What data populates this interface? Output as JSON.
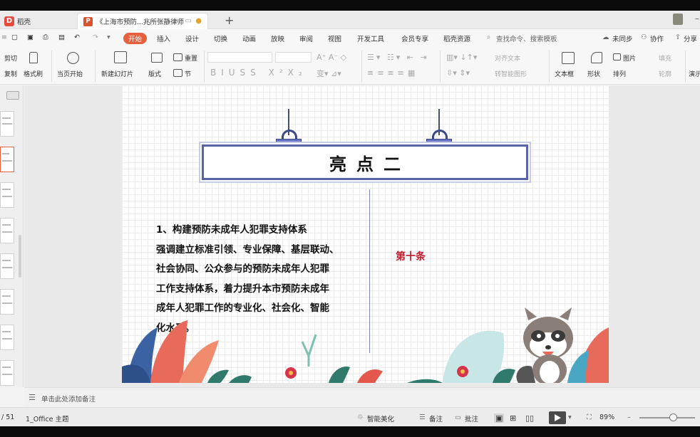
{
  "tabs": [
    {
      "label": "稻壳"
    },
    {
      "label": "《上海市预防...兆所张静律师"
    }
  ],
  "menu": {
    "start": "开始",
    "items": [
      "插入",
      "设计",
      "切换",
      "动画",
      "放映",
      "审阅",
      "视图",
      "开发工具",
      "会员专享",
      "稻壳资源"
    ],
    "search": "查找命令、搜索模板",
    "unsync": "未同步",
    "collab": "协作",
    "share": "分享"
  },
  "ribbon": {
    "cut": "剪切",
    "copy": "复制",
    "format_painter": "格式刷",
    "play_from_current": "当页开始",
    "new_slide": "新建幻灯片",
    "layout": "版式",
    "section": "节",
    "reset": "重置",
    "align_text": "对齐文本",
    "smartart": "转智能图形",
    "textbox": "文本框",
    "shape": "形状",
    "picture": "图片",
    "arrange": "排列",
    "fill": "填充",
    "outline": "轮廓",
    "present": "演示"
  },
  "slide": {
    "title": "亮点二",
    "body_lines": [
      "1、构建预防未成年人犯罪支持体系",
      "强调建立标准引领、专业保障、基层联动、",
      "社会协同、公众参与的预防未成年人犯罪",
      "工作支持体系，着力提升本市预防未成年",
      "成年人犯罪工作的专业化、社会化、智能",
      "化水平。"
    ],
    "article": "第十条"
  },
  "notes": {
    "placeholder": "单击此处添加备注"
  },
  "status": {
    "page": "/ 51",
    "theme": "1_Office 主题",
    "beautify": "智能美化",
    "notes": "备注",
    "comment": "批注",
    "zoom": "89%"
  },
  "colors": {
    "accent": "#e5603c",
    "title_border": "#5963a8",
    "article": "#c0192b"
  }
}
